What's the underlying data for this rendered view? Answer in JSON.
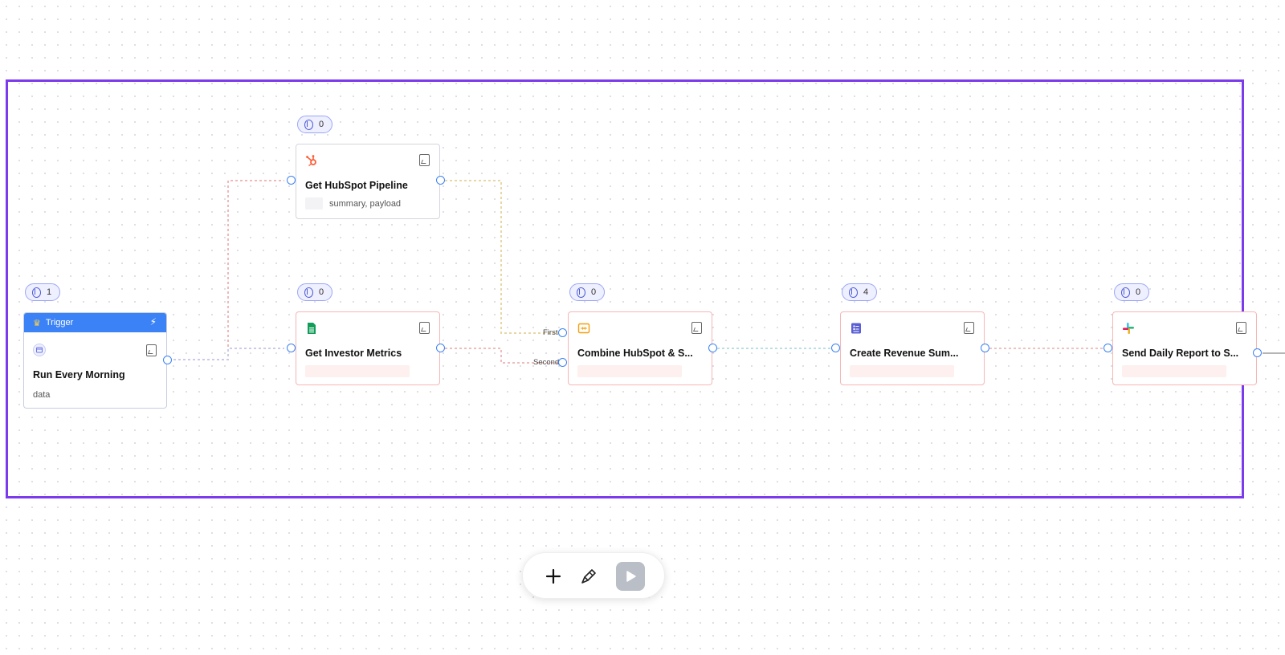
{
  "nodes": {
    "trigger": {
      "header": "Trigger",
      "badge": "1",
      "title": "Run Every Morning",
      "sub": "data"
    },
    "hubspot": {
      "badge": "0",
      "title": "Get HubSpot Pipeline",
      "sub": "summary, payload"
    },
    "investor": {
      "badge": "0",
      "title": "Get Investor Metrics"
    },
    "combine": {
      "badge": "0",
      "title": "Combine HubSpot & S...",
      "handles": [
        "First",
        "Second"
      ]
    },
    "revenue": {
      "badge": "4",
      "title": "Create Revenue Sum..."
    },
    "slack": {
      "badge": "0",
      "title": "Send Daily Report to S..."
    }
  },
  "toolbar": {
    "add_icon": "plus-icon",
    "brush_icon": "brush-icon",
    "run_icon": "play-icon"
  },
  "colors": {
    "frame": "#7c3aed",
    "trigger_header": "#3b82f6",
    "port": "#3b82f6",
    "badge_border": "#9aa6f7",
    "error_border": "#f6b6b6"
  }
}
